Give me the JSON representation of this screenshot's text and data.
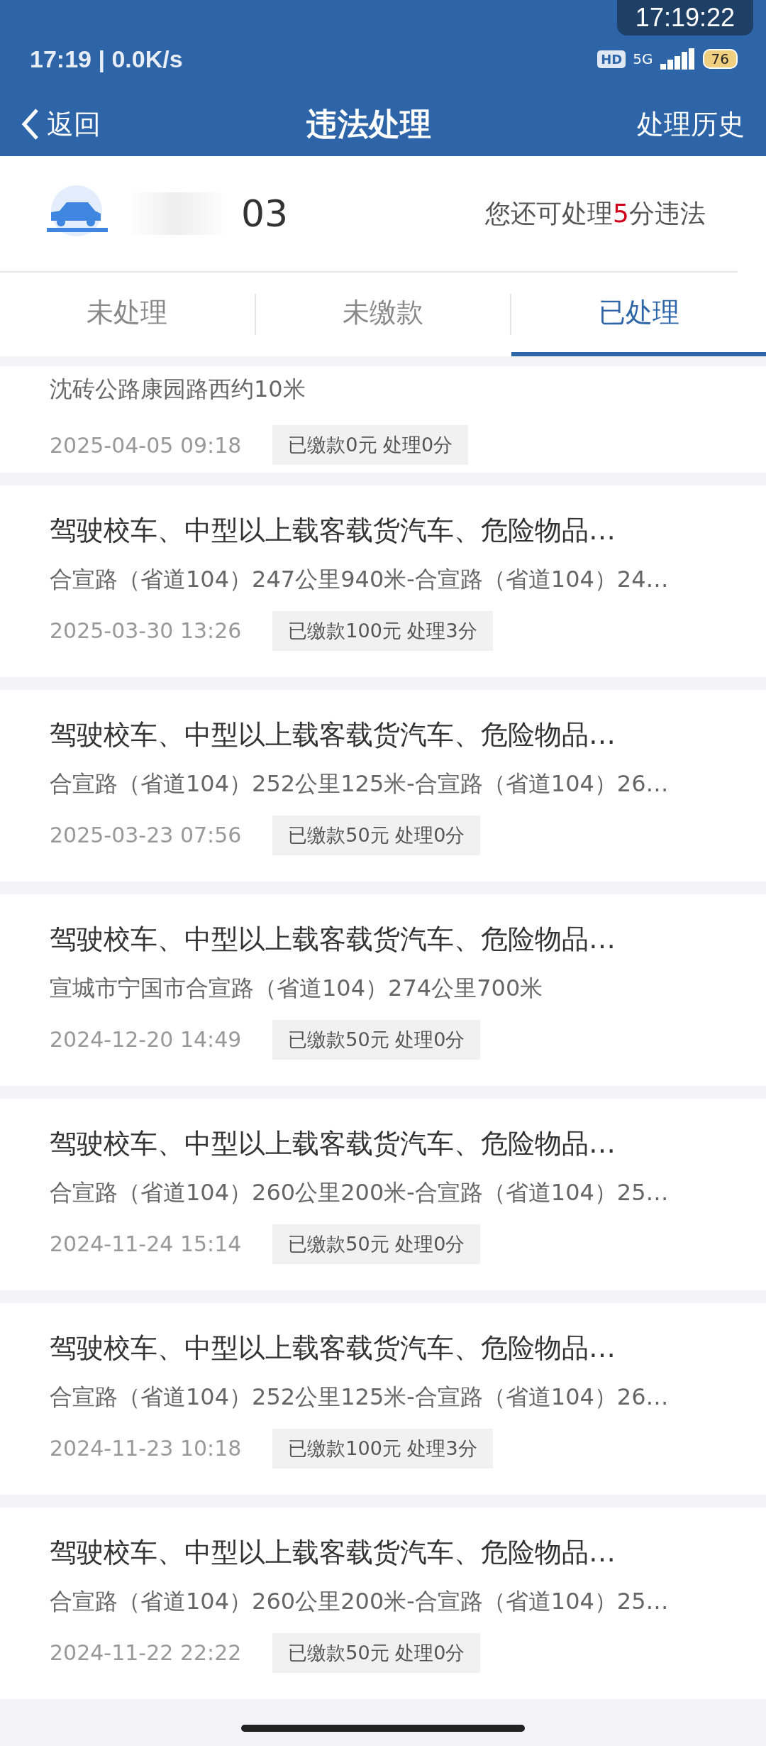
{
  "status_bar": {
    "time": "17:19",
    "separator": "|",
    "speed": "0.0K/s",
    "hd": "HD",
    "network": "5G",
    "battery": "76"
  },
  "overlay_clock": "17:19:22",
  "nav": {
    "back": "返回",
    "title": "违法处理",
    "action": "处理历史"
  },
  "vehicle": {
    "plate": "03",
    "quota_before": "您还可处理",
    "quota_points": "5",
    "quota_after": "分违法"
  },
  "tabs": [
    {
      "label": "未处理",
      "selected": false
    },
    {
      "label": "未缴款",
      "selected": false
    },
    {
      "label": "已处理",
      "selected": true
    }
  ],
  "records": [
    {
      "address": "沈砖公路康园路西约10米",
      "date": "2025-04-05 09:18",
      "result": "已缴款0元 处理0分"
    },
    {
      "title": "驾驶校车、中型以上载客载货汽车、危险物品…",
      "address": "合宣路（省道104）247公里940米-合宣路（省道104）24…",
      "date": "2025-03-30 13:26",
      "result": "已缴款100元 处理3分"
    },
    {
      "title": "驾驶校车、中型以上载客载货汽车、危险物品…",
      "address": "合宣路（省道104）252公里125米-合宣路（省道104）26…",
      "date": "2025-03-23 07:56",
      "result": "已缴款50元 处理0分"
    },
    {
      "title": "驾驶校车、中型以上载客载货汽车、危险物品…",
      "address": "宣城市宁国市合宣路（省道104）274公里700米",
      "date": "2024-12-20 14:49",
      "result": "已缴款50元 处理0分"
    },
    {
      "title": "驾驶校车、中型以上载客载货汽车、危险物品…",
      "address": "合宣路（省道104）260公里200米-合宣路（省道104）25…",
      "date": "2024-11-24 15:14",
      "result": "已缴款50元 处理0分"
    },
    {
      "title": "驾驶校车、中型以上载客载货汽车、危险物品…",
      "address": "合宣路（省道104）252公里125米-合宣路（省道104）26…",
      "date": "2024-11-23 10:18",
      "result": "已缴款100元 处理3分"
    },
    {
      "title": "驾驶校车、中型以上载客载货汽车、危险物品…",
      "address": "合宣路（省道104）260公里200米-合宣路（省道104）25…",
      "date": "2024-11-22 22:22",
      "result": "已缴款50元 处理0分"
    }
  ]
}
